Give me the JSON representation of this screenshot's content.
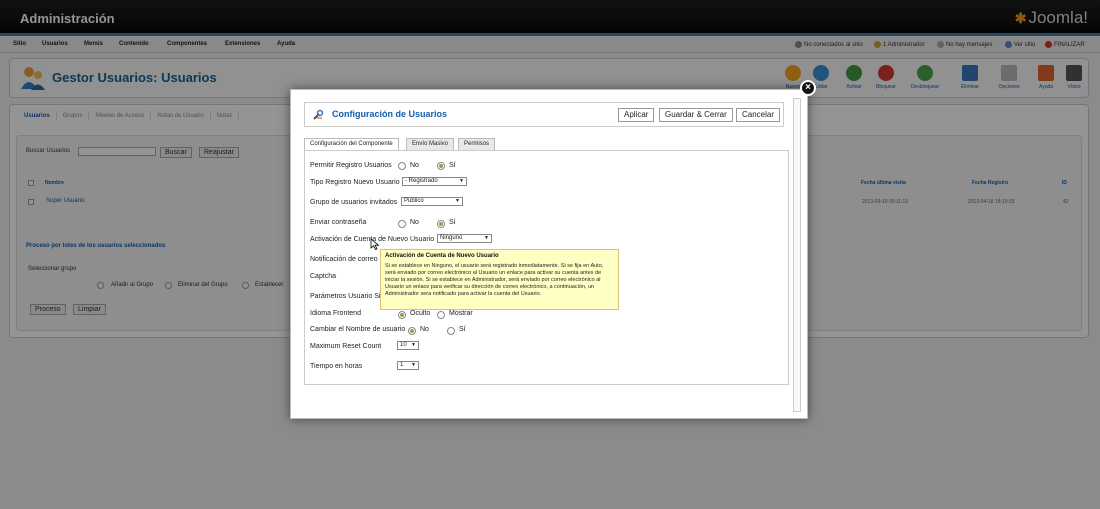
{
  "admin": {
    "title": "Administración",
    "logo_text": "Joomla!",
    "menu": [
      "Sitio",
      "Usuarios",
      "Menús",
      "Contenido",
      "Componentes",
      "Extensiones",
      "Ayuda"
    ],
    "status": {
      "not_connected": "No conectados al sitio",
      "admins": "1 Administrador",
      "messages": "No hay mensajes",
      "view_site": "Ver sitio",
      "logout": "FINALIZAR"
    },
    "page_title": "Gestor Usuarios: Usuarios",
    "toolbar": [
      "Nuevo",
      "Editar",
      "Activar",
      "Bloquear",
      "Desbloquear",
      "Eliminar",
      "Opciones",
      "Ayuda",
      "Vídeo"
    ],
    "subnav": [
      "Usuarios",
      "Grupos",
      "Niveles de Acceso",
      "Notas de Usuario",
      "Notas"
    ],
    "search_label": "Buscar Usuarios",
    "search_button": "Buscar",
    "clear_button": "Reajustar",
    "columns": {
      "name": "Nombre",
      "last_visit": "Fecha última visita",
      "register_date": "Fecha Registro",
      "id": "ID"
    },
    "row": {
      "name": "Super Usuario",
      "last_visit": "2013-09-19 09:11:13",
      "register_date": "2013-04-18 18:19:33",
      "id": "42"
    },
    "batch_title": "Proceso por lotes de los usuarios seleccionados",
    "select_group": "Seleccionar grupo",
    "batch_options": [
      "Añadir al Grupo",
      "Eliminar del Grupo",
      "Establecer"
    ],
    "process_button": "Proceso",
    "clear_batch_button": "Limpiar"
  },
  "modal": {
    "title": "Configuración de Usuarios",
    "buttons": {
      "apply": "Aplicar",
      "save_close": "Guardar & Cerrar",
      "cancel": "Cancelar"
    },
    "tabs": [
      "Configuración del Componente",
      "Envío Masivo",
      "Permisos"
    ],
    "fields": {
      "allow_registration": {
        "label": "Permitir Registro Usuarios",
        "no": "No",
        "yes": "Sí",
        "selected": "Sí"
      },
      "new_user_type": {
        "label": "Tipo Registro Nuevo Usuario",
        "value": "- Registrado"
      },
      "guest_group": {
        "label": "Grupo de usuarios invitados",
        "value": "Público"
      },
      "send_password": {
        "label": "Enviar contraseña",
        "no": "No",
        "yes": "Sí",
        "selected": "Sí"
      },
      "activation": {
        "label": "Activación de Cuenta de Nuevo Usuario",
        "value": "Ninguno"
      },
      "notification": {
        "label": "Notificación de correo a"
      },
      "captcha": {
        "label": "Captcha"
      },
      "user_params": {
        "label": "Parámetros Usuario Sit"
      },
      "frontend_language": {
        "label": "Idioma Frontend",
        "hidden": "Oculto",
        "show": "Mostrar",
        "selected": "Oculto"
      },
      "change_username": {
        "label": "Cambiar el Nombre de usuario",
        "no": "No",
        "yes": "Sí",
        "selected": "No"
      },
      "reset_count": {
        "label": "Maximum Reset Count",
        "value": "10"
      },
      "reset_time": {
        "label": "Tiempo en horas",
        "value": "1"
      }
    },
    "tooltip": {
      "title": "Activación de Cuenta de Nuevo Usuario",
      "text": "Si se establece en Ninguno, el usuario será registrado inmediatamente. Si se fija en Auto, será enviado por correo electrónico al Usuario un enlace para activar su cuenta antes de iniciar la sesión. Si se establece en Administrador, será enviado por correo electrónico al Usuario un enlace para verificar su dirección de correo electrónico, a continuación, un Administrador sera notificado para activar la cuenta del Usuario."
    }
  },
  "colors": {
    "brand_blue": "#135cae",
    "radio_checked": "#8aa63a",
    "tooltip_bg": "#ffffc4"
  }
}
